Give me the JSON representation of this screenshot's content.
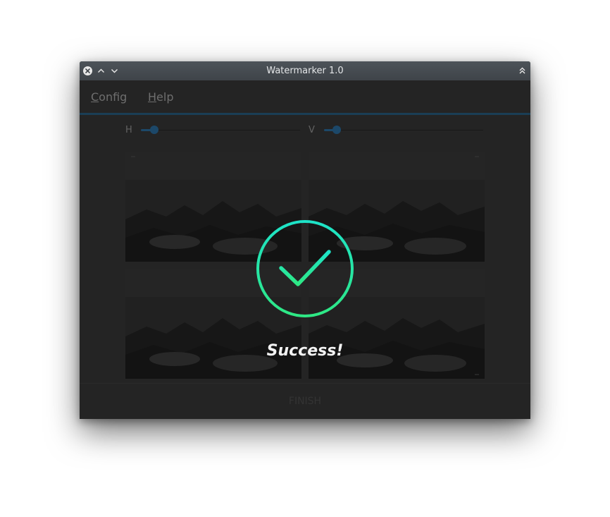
{
  "window": {
    "title": "Watermarker 1.0"
  },
  "menu": {
    "config": {
      "mnemonic": "C",
      "rest": "onfig"
    },
    "help": {
      "mnemonic": "H",
      "rest": "elp"
    }
  },
  "sliders": {
    "horizontal": {
      "label": "H"
    },
    "vertical": {
      "label": "V"
    }
  },
  "overlay": {
    "message": "Success!"
  },
  "footer": {
    "finish_label": "FINISH"
  },
  "colors": {
    "accent": "#1f5a86",
    "success_gradient_start": "#1ee3c8",
    "success_gradient_end": "#2ee884"
  },
  "icons": {
    "close": "close-icon",
    "minimize": "chevron-up-icon",
    "maximize": "chevron-down-icon",
    "keep_above": "double-chevron-up-icon",
    "success": "check-circle-icon"
  }
}
